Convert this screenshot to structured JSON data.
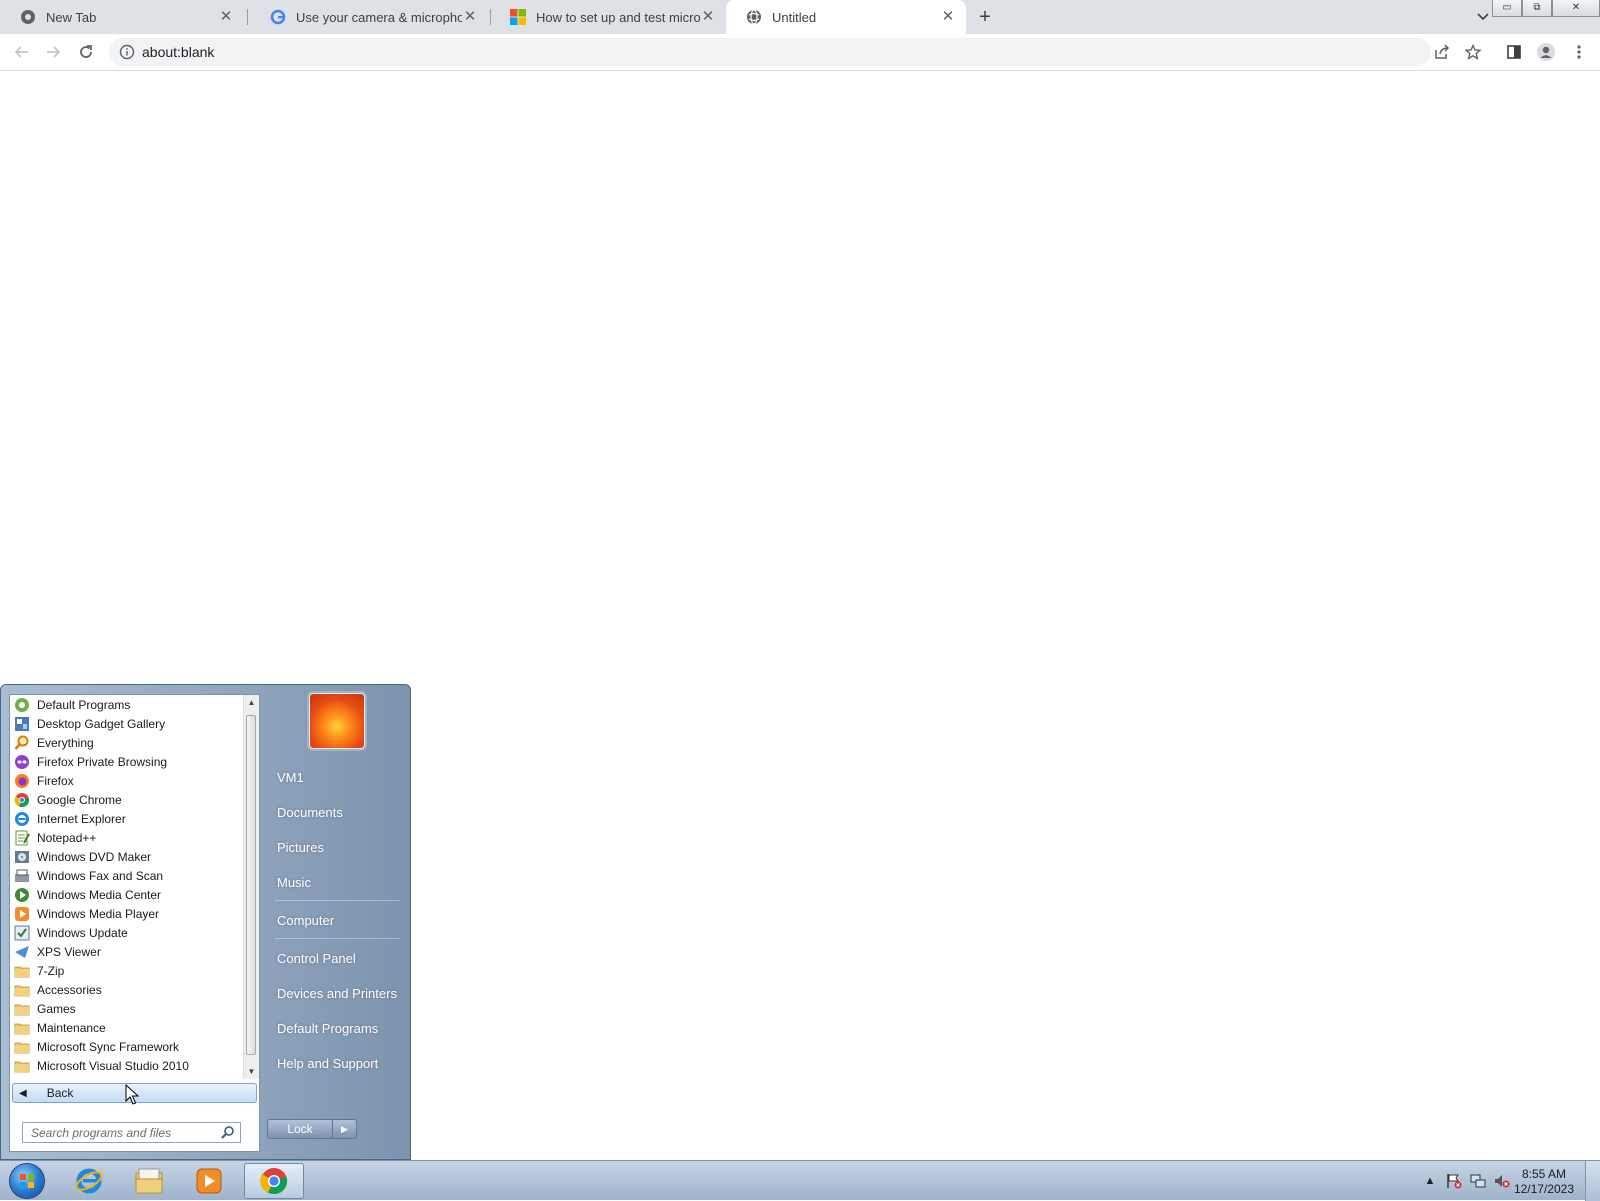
{
  "browser": {
    "tabs": [
      {
        "title": "New Tab",
        "icon": "chrome-icon",
        "active": false
      },
      {
        "title": "Use your camera & microphone",
        "icon": "google-icon",
        "active": false
      },
      {
        "title": "How to set up and test micropho",
        "icon": "microsoft-icon",
        "active": false
      },
      {
        "title": "Untitled",
        "icon": "globe-icon",
        "active": true
      }
    ],
    "url": "about:blank",
    "window_buttons": {
      "minimize": "▭",
      "maximize": "⧉",
      "close": "✕"
    }
  },
  "start_menu": {
    "programs": [
      {
        "label": "Default Programs",
        "icon": "default-programs-icon"
      },
      {
        "label": "Desktop Gadget Gallery",
        "icon": "gadget-gallery-icon"
      },
      {
        "label": "Everything",
        "icon": "everything-search-icon"
      },
      {
        "label": "Firefox Private Browsing",
        "icon": "firefox-private-icon"
      },
      {
        "label": "Firefox",
        "icon": "firefox-icon"
      },
      {
        "label": "Google Chrome",
        "icon": "chrome-icon"
      },
      {
        "label": "Internet Explorer",
        "icon": "ie-icon"
      },
      {
        "label": "Notepad++",
        "icon": "notepadpp-icon"
      },
      {
        "label": "Windows DVD Maker",
        "icon": "dvd-maker-icon"
      },
      {
        "label": "Windows Fax and Scan",
        "icon": "fax-scan-icon"
      },
      {
        "label": "Windows Media Center",
        "icon": "media-center-icon"
      },
      {
        "label": "Windows Media Player",
        "icon": "media-player-icon"
      },
      {
        "label": "Windows Update",
        "icon": "windows-update-icon"
      },
      {
        "label": "XPS Viewer",
        "icon": "xps-viewer-icon"
      },
      {
        "label": "7-Zip",
        "icon": "folder-icon"
      },
      {
        "label": "Accessories",
        "icon": "folder-icon"
      },
      {
        "label": "Games",
        "icon": "folder-icon"
      },
      {
        "label": "Maintenance",
        "icon": "folder-icon"
      },
      {
        "label": "Microsoft Sync Framework",
        "icon": "folder-icon"
      },
      {
        "label": "Microsoft Visual Studio 2010",
        "icon": "folder-icon"
      }
    ],
    "back_label": "Back",
    "search_placeholder": "Search programs and files",
    "right_items": {
      "user": "VM1",
      "documents": "Documents",
      "pictures": "Pictures",
      "music": "Music",
      "computer": "Computer",
      "control_panel": "Control Panel",
      "devices": "Devices and Printers",
      "default_programs": "Default Programs",
      "help": "Help and Support"
    },
    "lock_label": "Lock"
  },
  "taskbar": {
    "pinned": [
      "start-orb",
      "internet-explorer-icon",
      "file-explorer-icon",
      "media-player-icon",
      "chrome-icon"
    ],
    "clock": {
      "time": "8:55 AM",
      "date": "12/17/2023"
    }
  },
  "colors": {
    "tabstrip": "#dee1e6",
    "start_menu_blue": "#7d94ae",
    "back_button": "#c4dcf7",
    "taskbar": "#b3c4d9"
  }
}
